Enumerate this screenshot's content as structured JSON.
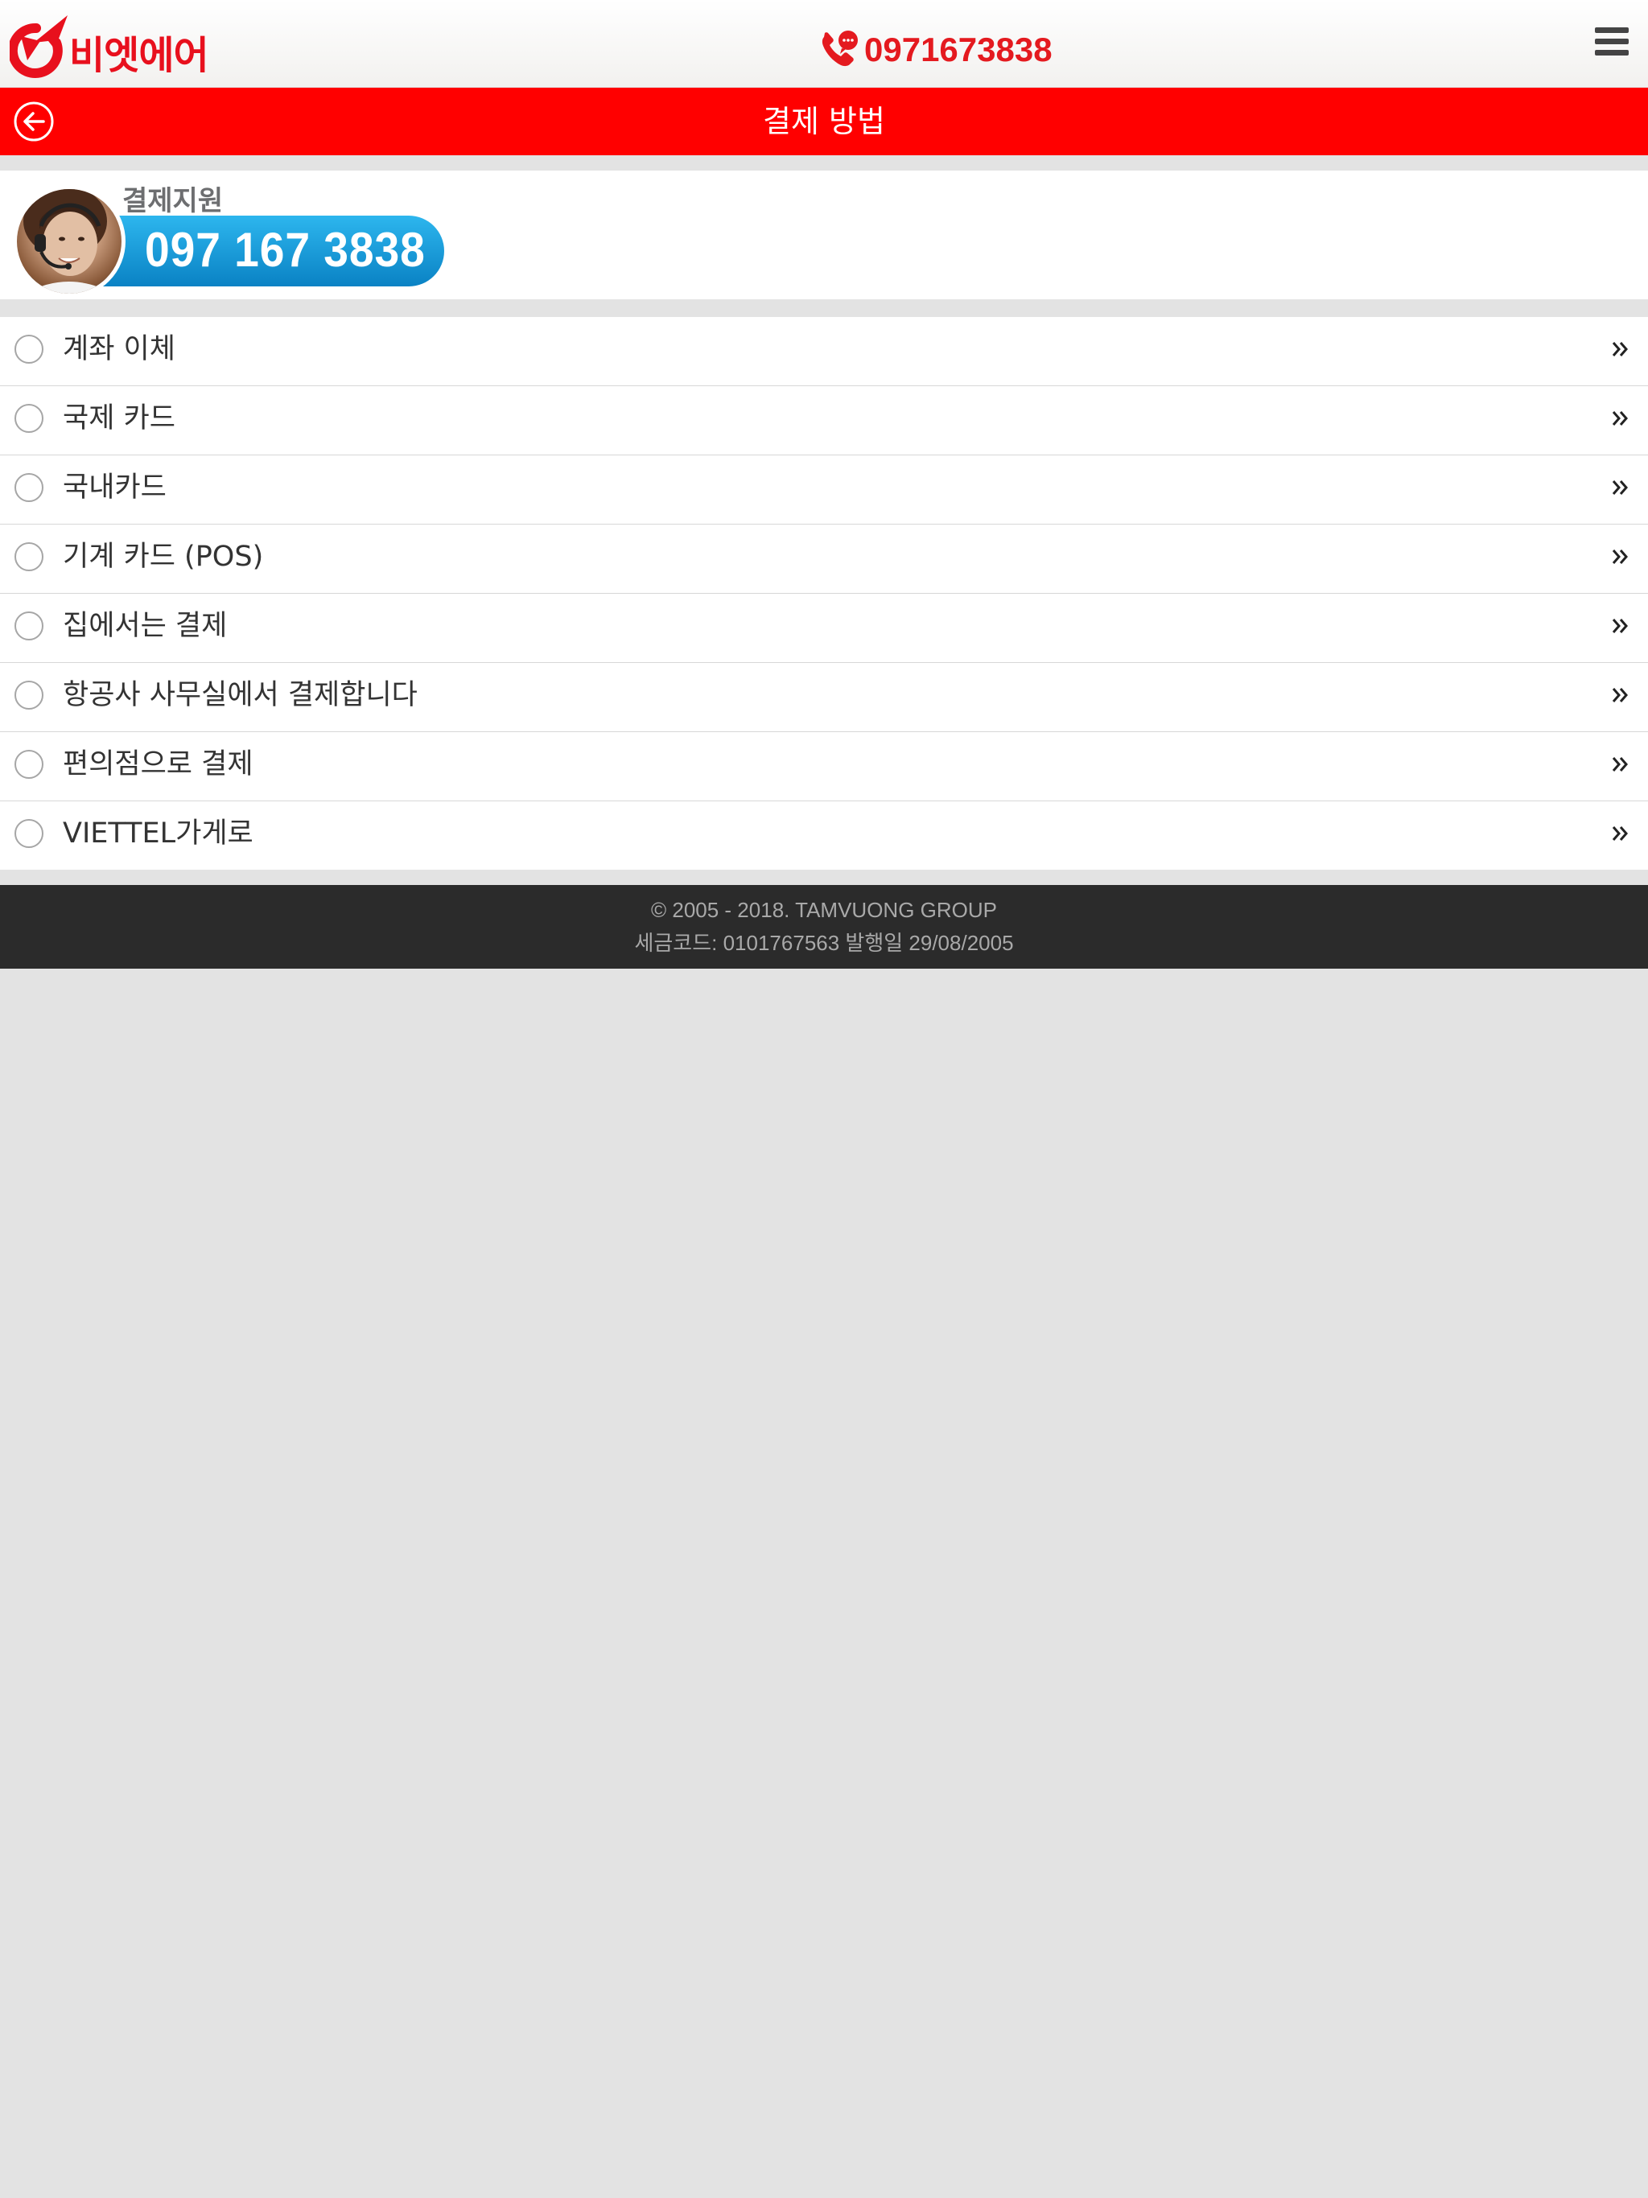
{
  "header": {
    "logo_text": "비엣에어",
    "phone": "0971673838"
  },
  "titlebar": {
    "title": "결제 방법"
  },
  "support": {
    "label": "결제지원",
    "phone": "097 167 3838"
  },
  "payment_methods": [
    {
      "label": "계좌 이체"
    },
    {
      "label": "국제 카드"
    },
    {
      "label": "국내카드"
    },
    {
      "label": "기계 카드 (POS)"
    },
    {
      "label": "집에서는 결제"
    },
    {
      "label": "항공사 사무실에서 결제합니다"
    },
    {
      "label": "편의점으로 결제"
    },
    {
      "label": "VIETTEL가게로"
    }
  ],
  "footer": {
    "copyright": "© 2005 - 2018. TAMVUONG GROUP",
    "tax_info": "세금코드: 0101767563 발행일 29/08/2005"
  },
  "colors": {
    "brand_red": "#ff0000",
    "logo_red": "#e8101d",
    "support_blue": "#0a82c4",
    "footer_bg": "#2b2b2b",
    "page_bg": "#e3e3e3"
  },
  "icons": {
    "logo": "plane-logo-icon",
    "phone": "phone-chat-icon",
    "menu": "hamburger-menu-icon",
    "back": "back-arrow-circle-icon",
    "radio": "radio-empty-icon",
    "chevron": "double-chevron-right-icon"
  }
}
